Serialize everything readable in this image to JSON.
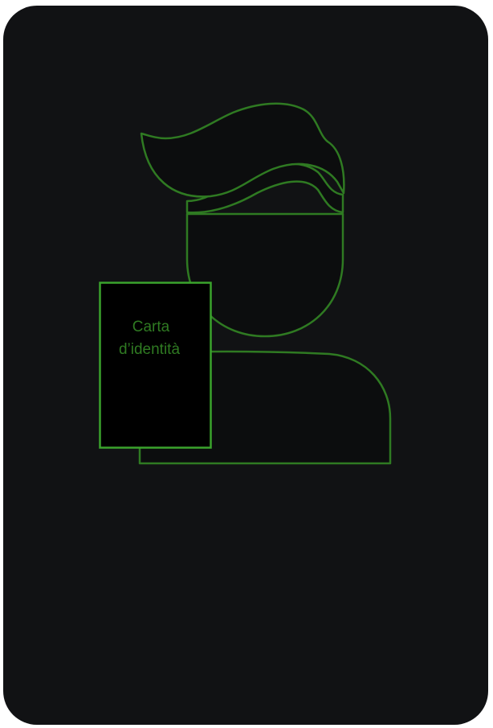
{
  "colors": {
    "panel": "#111214",
    "stroke": "#2f7a22",
    "card_stroke": "#3aa32c",
    "card_fill": "#000000",
    "label": "#2f7a22"
  },
  "icons": {
    "person": "person-silhouette-icon",
    "card": "id-card-icon"
  },
  "id_card": {
    "label_line1": "Carta",
    "label_line2": "d’identità"
  }
}
